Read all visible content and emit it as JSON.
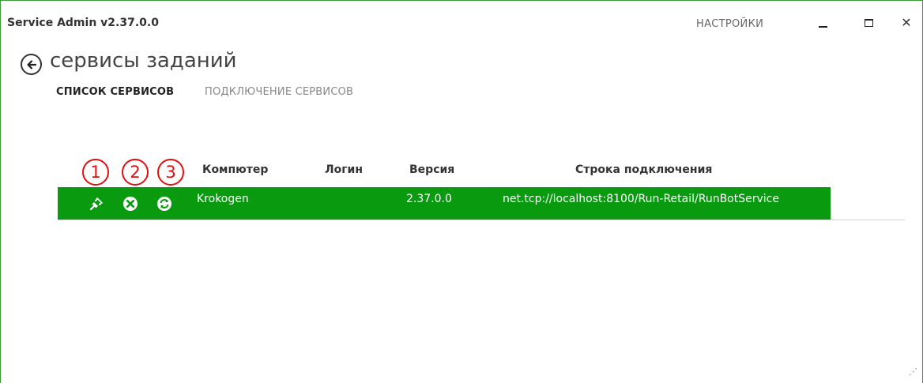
{
  "window": {
    "title": "Service Admin  v2.37.0.0",
    "settings_label": "НАСТРОЙКИ",
    "accent_color": "#0a9a10",
    "border_color": "#3a9a3a"
  },
  "header": {
    "title": "сервисы заданий",
    "back_icon": "arrow-left-icon"
  },
  "tabs": [
    {
      "label": "СПИСОК СЕРВИСОВ",
      "active": true
    },
    {
      "label": "ПОДКЛЮЧЕНИЕ СЕРВИСОВ",
      "active": false
    }
  ],
  "annotations": [
    "1",
    "2",
    "3"
  ],
  "table": {
    "columns": [
      "Компютер",
      "Логин",
      "Версия",
      "Строка подключения"
    ],
    "rows": [
      {
        "computer": "Krokogen",
        "login": "",
        "version": "2.37.0.0",
        "connection": "net.tcp://localhost:8100/Run-Retail/RunBotService",
        "icons": [
          "disconnect-plug-icon",
          "remove-circle-icon",
          "refresh-icon"
        ]
      }
    ]
  }
}
